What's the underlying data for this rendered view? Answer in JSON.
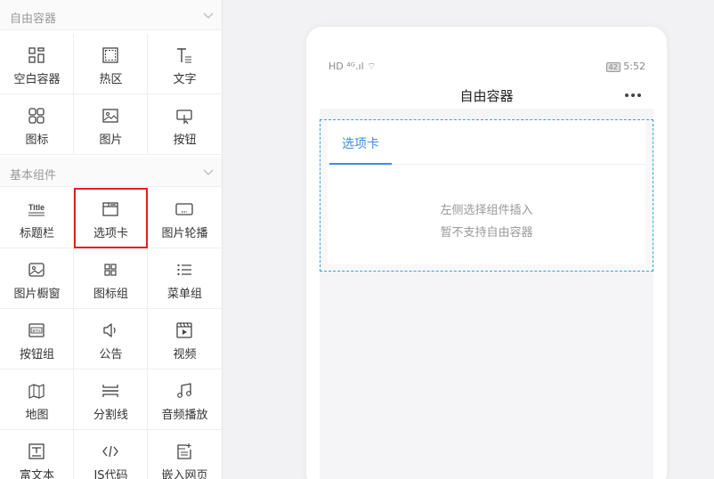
{
  "sections": [
    {
      "title": "自由容器",
      "items": [
        {
          "label": "空白容器",
          "icon": "grid-blank-icon"
        },
        {
          "label": "热区",
          "icon": "hotspot-icon"
        },
        {
          "label": "文字",
          "icon": "text-icon"
        },
        {
          "label": "图标",
          "icon": "icon-grid-icon"
        },
        {
          "label": "图片",
          "icon": "image-icon"
        },
        {
          "label": "按钮",
          "icon": "button-icon"
        }
      ]
    },
    {
      "title": "基本组件",
      "items": [
        {
          "label": "标题栏",
          "icon": "title-bar-icon",
          "icon_text": "Title"
        },
        {
          "label": "选项卡",
          "icon": "tabs-icon",
          "selected": true
        },
        {
          "label": "图片轮播",
          "icon": "carousel-icon"
        },
        {
          "label": "图片橱窗",
          "icon": "image-showcase-icon"
        },
        {
          "label": "图标组",
          "icon": "icon-group-icon"
        },
        {
          "label": "菜单组",
          "icon": "menu-group-icon"
        },
        {
          "label": "按钮组",
          "icon": "button-group-icon",
          "icon_text": "BTN"
        },
        {
          "label": "公告",
          "icon": "speaker-icon"
        },
        {
          "label": "视频",
          "icon": "video-icon"
        },
        {
          "label": "地图",
          "icon": "map-icon"
        },
        {
          "label": "分割线",
          "icon": "divider-icon"
        },
        {
          "label": "音频播放",
          "icon": "music-icon"
        },
        {
          "label": "富文本",
          "icon": "rich-text-icon"
        },
        {
          "label": "JS代码",
          "icon": "code-icon"
        },
        {
          "label": "嵌入网页",
          "icon": "embed-web-icon"
        }
      ]
    }
  ],
  "phone": {
    "status_left": "HD ⁴ᴳ.ıl ⌔",
    "battery": "42",
    "time": "5:52",
    "title": "自由容器",
    "more_icon": "more-dots-icon",
    "tab_label": "选项卡",
    "hint_line1": "左侧选择组件插入",
    "hint_line2": "暂不支持自由容器"
  },
  "colors": {
    "accent": "#3c8edc",
    "dashed_border": "#36a3d6",
    "selected_outline": "#e02020"
  }
}
